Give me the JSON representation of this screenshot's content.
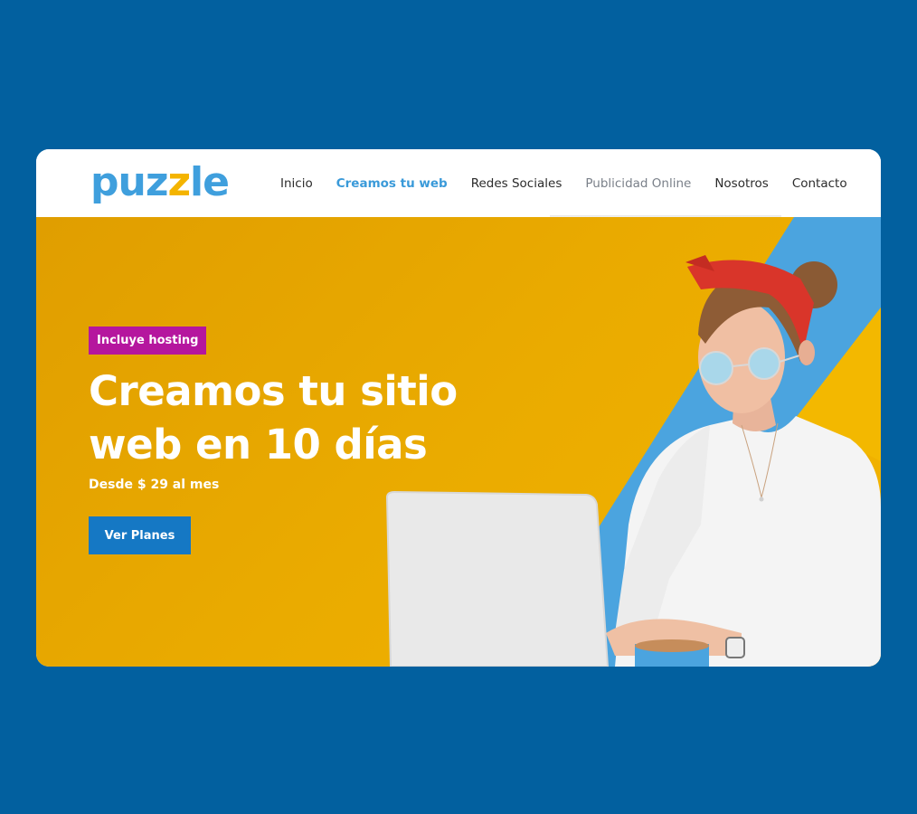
{
  "brand": {
    "logo_text_1": "puz",
    "logo_text_2": "z",
    "logo_text_3": "le",
    "colors": {
      "background": "#02609f",
      "primary_blue": "#3f9fdd",
      "accent_yellow": "#f4b400",
      "badge_magenta": "#b5169e",
      "button_blue": "#1578c4"
    }
  },
  "nav": {
    "items": [
      {
        "label": "Inicio",
        "state": "default"
      },
      {
        "label": "Creamos tu web",
        "state": "active"
      },
      {
        "label": "Redes Sociales",
        "state": "default"
      },
      {
        "label": "Publicidad Online",
        "state": "hover"
      },
      {
        "label": "Nosotros",
        "state": "default"
      },
      {
        "label": "Contacto",
        "state": "default"
      }
    ]
  },
  "hero": {
    "badge": "Incluye hosting",
    "headline_line1": "Creamos tu sitio",
    "headline_line2": "web en 10 días",
    "subheadline": "Desde $ 29 al mes",
    "cta_label": "Ver Planes",
    "image_description_icon": "woman-with-laptop-illustration"
  }
}
